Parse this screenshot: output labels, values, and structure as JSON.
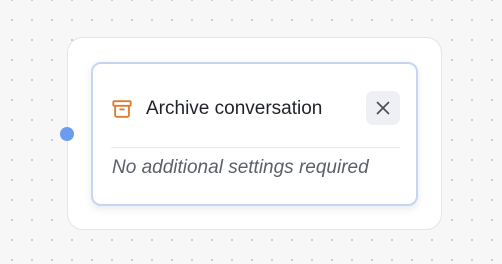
{
  "node": {
    "title": "Archive conversation",
    "icon": "archive-box-icon",
    "close_icon": "close-x-icon",
    "settings_note": "No additional settings required"
  },
  "colors": {
    "icon_accent": "#e07a2e",
    "handle": "#6b9cf0",
    "card_border": "#c6d6f2"
  }
}
